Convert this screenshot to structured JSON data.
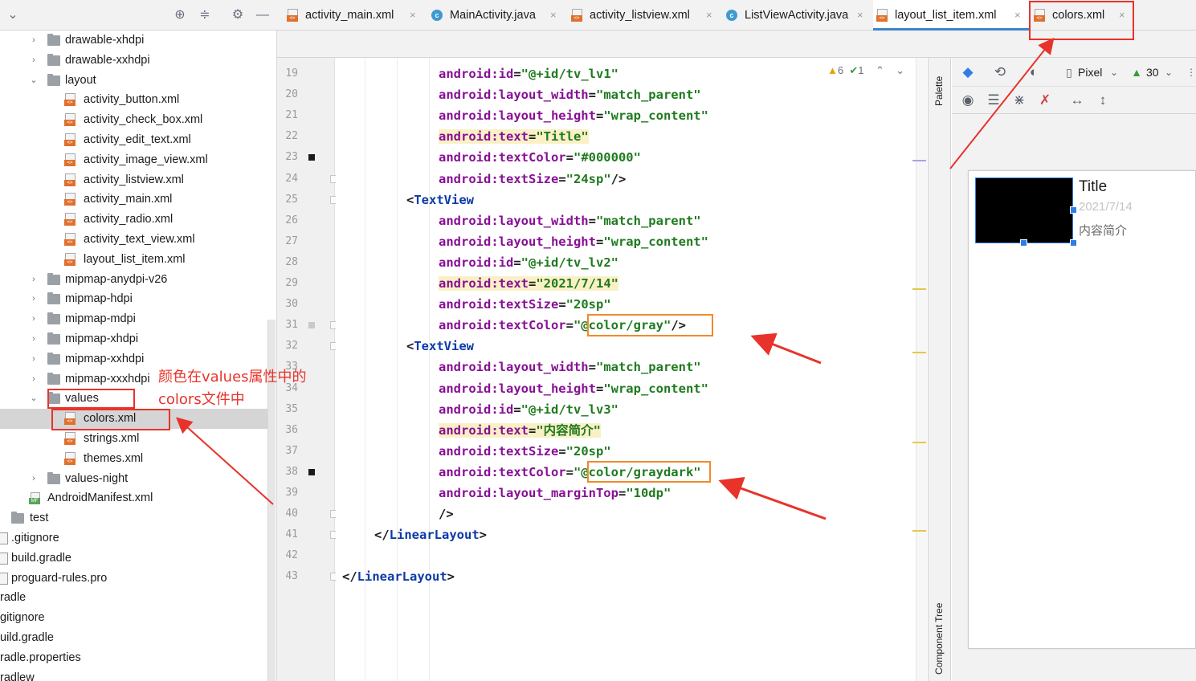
{
  "project": {
    "toolbar_icons": [
      "crosshair-icon",
      "collapse-all-icon",
      "gear-icon",
      "minimize-icon"
    ],
    "tree": [
      {
        "label": "drawable-xhdpi",
        "kind": "folder",
        "chevron": "›",
        "indent": 1
      },
      {
        "label": "drawable-xxhdpi",
        "kind": "folder",
        "chevron": "›",
        "indent": 1
      },
      {
        "label": "layout",
        "kind": "folder",
        "chevron": "⌄",
        "indent": 1
      },
      {
        "label": "activity_button.xml",
        "kind": "xml",
        "indent": 2
      },
      {
        "label": "activity_check_box.xml",
        "kind": "xml",
        "indent": 2
      },
      {
        "label": "activity_edit_text.xml",
        "kind": "xml",
        "indent": 2
      },
      {
        "label": "activity_image_view.xml",
        "kind": "xml",
        "indent": 2
      },
      {
        "label": "activity_listview.xml",
        "kind": "xml",
        "indent": 2
      },
      {
        "label": "activity_main.xml",
        "kind": "xml",
        "indent": 2
      },
      {
        "label": "activity_radio.xml",
        "kind": "xml",
        "indent": 2
      },
      {
        "label": "activity_text_view.xml",
        "kind": "xml",
        "indent": 2
      },
      {
        "label": "layout_list_item.xml",
        "kind": "xml",
        "indent": 2
      },
      {
        "label": "mipmap-anydpi-v26",
        "kind": "folder",
        "chevron": "›",
        "indent": 1
      },
      {
        "label": "mipmap-hdpi",
        "kind": "folder",
        "chevron": "›",
        "indent": 1
      },
      {
        "label": "mipmap-mdpi",
        "kind": "folder",
        "chevron": "›",
        "indent": 1
      },
      {
        "label": "mipmap-xhdpi",
        "kind": "folder",
        "chevron": "›",
        "indent": 1
      },
      {
        "label": "mipmap-xxhdpi",
        "kind": "folder",
        "chevron": "›",
        "indent": 1
      },
      {
        "label": "mipmap-xxxhdpi",
        "kind": "folder",
        "chevron": "›",
        "indent": 1
      },
      {
        "label": "values",
        "kind": "folder",
        "chevron": "⌄",
        "indent": 1
      },
      {
        "label": "colors.xml",
        "kind": "xml",
        "indent": 2,
        "selected": true
      },
      {
        "label": "strings.xml",
        "kind": "xml",
        "indent": 2
      },
      {
        "label": "themes.xml",
        "kind": "xml",
        "indent": 2
      },
      {
        "label": "values-night",
        "kind": "folder",
        "chevron": "›",
        "indent": 1
      },
      {
        "label": "AndroidManifest.xml",
        "kind": "manifest",
        "indent": 0
      },
      {
        "label": "test",
        "kind": "folder",
        "indent": -1
      },
      {
        "label": ".gitignore",
        "kind": "file",
        "indent": -2
      },
      {
        "label": "build.gradle",
        "kind": "file",
        "indent": -2
      },
      {
        "label": "proguard-rules.pro",
        "kind": "file",
        "indent": -2
      },
      {
        "label": "radle",
        "kind": "plain",
        "indent": -3
      },
      {
        "label": "gitignore",
        "kind": "plain",
        "indent": -3
      },
      {
        "label": "uild.gradle",
        "kind": "plain",
        "indent": -3
      },
      {
        "label": "radle.properties",
        "kind": "plain",
        "indent": -3
      },
      {
        "label": "radlew",
        "kind": "plain",
        "indent": -3
      }
    ]
  },
  "tabs": [
    {
      "label": "activity_main.xml",
      "icon": "xml-file-icon"
    },
    {
      "label": "MainActivity.java",
      "icon": "java-class-icon"
    },
    {
      "label": "activity_listview.xml",
      "icon": "xml-file-icon"
    },
    {
      "label": "ListViewActivity.java",
      "icon": "java-class-icon"
    },
    {
      "label": "layout_list_item.xml",
      "icon": "xml-file-icon",
      "active": true
    },
    {
      "label": "colors.xml",
      "icon": "xml-file-icon"
    }
  ],
  "tab_close_glyph": "×",
  "inspections": {
    "warnings": "6",
    "ok": "1"
  },
  "code_lines": [
    {
      "num": "19",
      "indent": 12,
      "tokens": [
        [
          "k",
          "android:id"
        ],
        [
          "p",
          "="
        ],
        [
          "v",
          "\"@+id/tv_lv1\""
        ]
      ]
    },
    {
      "num": "20",
      "indent": 12,
      "tokens": [
        [
          "k",
          "android:layout_width"
        ],
        [
          "p",
          "="
        ],
        [
          "v",
          "\"match_parent\""
        ]
      ]
    },
    {
      "num": "21",
      "indent": 12,
      "tokens": [
        [
          "k",
          "android:layout_height"
        ],
        [
          "p",
          "="
        ],
        [
          "v",
          "\"wrap_content\""
        ]
      ]
    },
    {
      "num": "22",
      "indent": 12,
      "hl": true,
      "tokens": [
        [
          "k",
          "android:text"
        ],
        [
          "p",
          "="
        ],
        [
          "v",
          "\"Title\""
        ]
      ]
    },
    {
      "num": "23",
      "indent": 12,
      "tokens": [
        [
          "k",
          "android:textColor"
        ],
        [
          "p",
          "="
        ],
        [
          "v",
          "\"#000000\""
        ]
      ]
    },
    {
      "num": "24",
      "indent": 12,
      "tokens": [
        [
          "k",
          "android:textSize"
        ],
        [
          "p",
          "="
        ],
        [
          "v",
          "\"24sp\""
        ],
        [
          "p",
          "/>"
        ]
      ]
    },
    {
      "num": "25",
      "indent": 8,
      "tokens": [
        [
          "p",
          "<"
        ],
        [
          "t",
          "TextView"
        ]
      ]
    },
    {
      "num": "26",
      "indent": 12,
      "tokens": [
        [
          "k",
          "android:layout_width"
        ],
        [
          "p",
          "="
        ],
        [
          "v",
          "\"match_parent\""
        ]
      ]
    },
    {
      "num": "27",
      "indent": 12,
      "tokens": [
        [
          "k",
          "android:layout_height"
        ],
        [
          "p",
          "="
        ],
        [
          "v",
          "\"wrap_content\""
        ]
      ]
    },
    {
      "num": "28",
      "indent": 12,
      "tokens": [
        [
          "k",
          "android:id"
        ],
        [
          "p",
          "="
        ],
        [
          "v",
          "\"@+id/tv_lv2\""
        ]
      ]
    },
    {
      "num": "29",
      "indent": 12,
      "hl": true,
      "tokens": [
        [
          "k",
          "android:text"
        ],
        [
          "p",
          "="
        ],
        [
          "v",
          "\"2021/7/14\""
        ]
      ]
    },
    {
      "num": "30",
      "indent": 12,
      "tokens": [
        [
          "k",
          "android:textSize"
        ],
        [
          "p",
          "="
        ],
        [
          "v",
          "\"20sp\""
        ]
      ]
    },
    {
      "num": "31",
      "indent": 12,
      "tokens": [
        [
          "k",
          "android:textColor"
        ],
        [
          "p",
          "="
        ],
        [
          "v",
          "\"@color/gray\""
        ],
        [
          "p",
          "/>"
        ]
      ]
    },
    {
      "num": "32",
      "indent": 8,
      "tokens": [
        [
          "p",
          "<"
        ],
        [
          "t",
          "TextView"
        ]
      ]
    },
    {
      "num": "33",
      "indent": 12,
      "tokens": [
        [
          "k",
          "android:layout_width"
        ],
        [
          "p",
          "="
        ],
        [
          "v",
          "\"match_parent\""
        ]
      ]
    },
    {
      "num": "34",
      "indent": 12,
      "tokens": [
        [
          "k",
          "android:layout_height"
        ],
        [
          "p",
          "="
        ],
        [
          "v",
          "\"wrap_content\""
        ]
      ]
    },
    {
      "num": "35",
      "indent": 12,
      "tokens": [
        [
          "k",
          "android:id"
        ],
        [
          "p",
          "="
        ],
        [
          "v",
          "\"@+id/tv_lv3\""
        ]
      ]
    },
    {
      "num": "36",
      "indent": 12,
      "hl": true,
      "tokens": [
        [
          "k",
          "android:text"
        ],
        [
          "p",
          "="
        ],
        [
          "v",
          "\"内容简介\""
        ]
      ]
    },
    {
      "num": "37",
      "indent": 12,
      "tokens": [
        [
          "k",
          "android:textSize"
        ],
        [
          "p",
          "="
        ],
        [
          "v",
          "\"20sp\""
        ]
      ]
    },
    {
      "num": "38",
      "indent": 12,
      "tokens": [
        [
          "k",
          "android:textColor"
        ],
        [
          "p",
          "="
        ],
        [
          "v",
          "\"@color/graydark\""
        ]
      ]
    },
    {
      "num": "39",
      "indent": 12,
      "tokens": [
        [
          "k",
          "android:layout_marginTop"
        ],
        [
          "p",
          "="
        ],
        [
          "v",
          "\"10dp\""
        ]
      ]
    },
    {
      "num": "40",
      "indent": 12,
      "tokens": [
        [
          "p",
          "/>"
        ]
      ]
    },
    {
      "num": "41",
      "indent": 4,
      "tokens": [
        [
          "p",
          "</"
        ],
        [
          "t",
          "LinearLayout"
        ],
        [
          "p",
          ">"
        ]
      ]
    },
    {
      "num": "42",
      "indent": 0,
      "tokens": []
    },
    {
      "num": "43",
      "indent": 0,
      "tokens": [
        [
          "p",
          "</"
        ],
        [
          "t",
          "LinearLayout"
        ],
        [
          "p",
          ">"
        ]
      ]
    }
  ],
  "side_strips": {
    "palette": "Palette",
    "component_tree": "Component Tree"
  },
  "design_toolbar": {
    "device": "Pixel",
    "api": "30"
  },
  "preview": {
    "title": "Title",
    "date": "2021/7/14",
    "description": "内容简介"
  },
  "annotation": {
    "line1": "颜色在values属性中的",
    "line2": "colors文件中"
  },
  "colors": {
    "annotation_red": "#e8332b",
    "highlight_orange": "#f08a2c",
    "selection_blue": "#2f7ee8"
  }
}
